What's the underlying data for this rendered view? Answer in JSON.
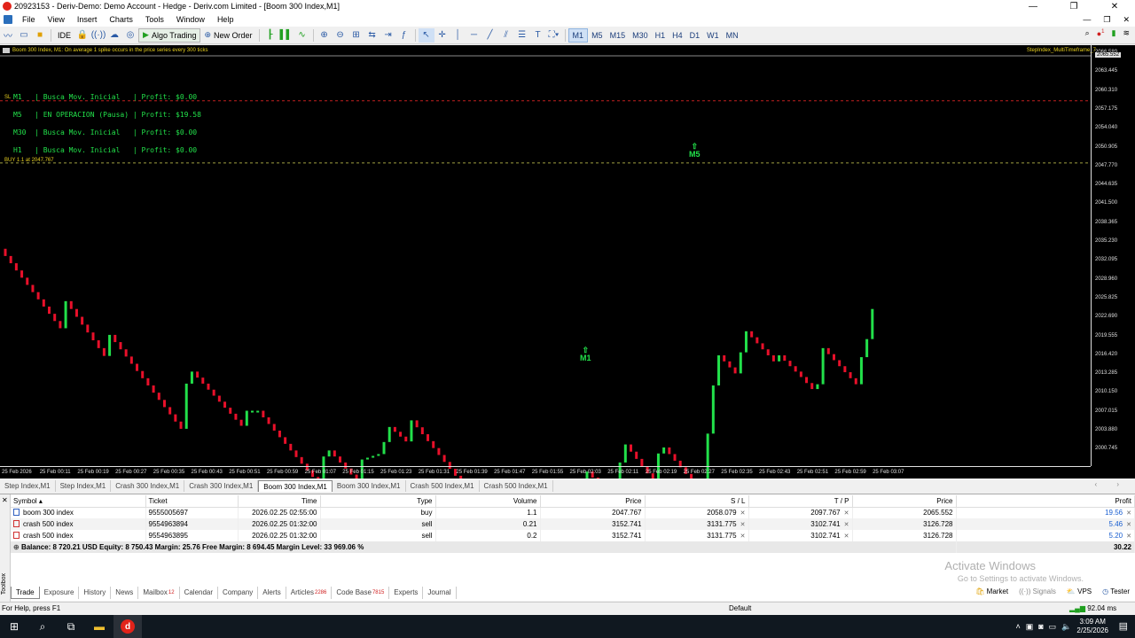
{
  "window": {
    "title": "20923153 - Deriv-Demo: Demo Account - Hedge - Deriv.com Limited - [Boom 300 Index,M1]",
    "minimize": "—",
    "maximize": "❐",
    "close": "✕"
  },
  "menu": {
    "items": [
      "File",
      "View",
      "Insert",
      "Charts",
      "Tools",
      "Window",
      "Help"
    ],
    "mdi_minimize": "—",
    "mdi_restore": "❐",
    "mdi_close": "✕"
  },
  "toolbar": {
    "ide_label": "IDE",
    "algo_trading_label": "Algo Trading",
    "new_order_label": "New Order",
    "timeframes": [
      "M1",
      "M5",
      "M15",
      "M30",
      "H1",
      "H4",
      "D1",
      "W1",
      "MN"
    ],
    "active_timeframe": "M1",
    "notification_count": "1"
  },
  "chart": {
    "header": "Boom 300 Index, M1:  On average 1 spike occurs in the price series every 300 ticks",
    "indicator": "StepIndex_MultiTimeframe_7",
    "sl_tag": "SL",
    "status_lines": [
      "M1   | Busca Mov. Inicial   | Profit: $0.00",
      "M5   | EN OPERACION (Pausa) | Profit: $19.58",
      "M30  | Busca Mov. Inicial   | Profit: $0.00",
      "H1   | Busca Mov. Inicial   | Profit: $0.00"
    ],
    "buy_label": "BUY 1.1 at 2047.767",
    "current_price": "2065.552",
    "price_labels": [
      "2066.580",
      "2063.445",
      "2060.310",
      "2057.175",
      "2054.040",
      "2050.905",
      "2047.770",
      "2044.635",
      "2041.500",
      "2038.365",
      "2035.230",
      "2032.095",
      "2028.960",
      "2025.825",
      "2022.690",
      "2019.555",
      "2016.420",
      "2013.285",
      "2010.150",
      "2007.015",
      "2003.880",
      "2000.745"
    ],
    "time_labels": [
      "25 Feb 2026",
      "25 Feb 00:11",
      "25 Feb 00:19",
      "25 Feb 00:27",
      "25 Feb 00:35",
      "25 Feb 00:43",
      "25 Feb 00:51",
      "25 Feb 00:59",
      "25 Feb 01:07",
      "25 Feb 01:15",
      "25 Feb 01:23",
      "25 Feb 01:31",
      "25 Feb 01:39",
      "25 Feb 01:47",
      "25 Feb 01:55",
      "25 Feb 02:03",
      "25 Feb 02:11",
      "25 Feb 02:19",
      "25 Feb 02:27",
      "25 Feb 02:35",
      "25 Feb 02:43",
      "25 Feb 02:51",
      "25 Feb 02:59",
      "25 Feb 03:07"
    ],
    "markers": [
      "M1",
      "M5"
    ],
    "colors": {
      "bull": "#22e04a",
      "bear": "#e8102a",
      "background": "#000000",
      "text": "#e8d020",
      "status": "#22e04a"
    }
  },
  "chart_tabs": [
    "Step Index,M1",
    "Step Index,M1",
    "Crash 300 Index,M1",
    "Crash 300 Index,M1",
    "Boom 300 Index,M1",
    "Boom 300 Index,M1",
    "Crash 500 Index,M1",
    "Crash 500 Index,M1"
  ],
  "active_chart_tab": 4,
  "trade": {
    "columns": [
      "Symbol",
      "Ticket",
      "Time",
      "Type",
      "Volume",
      "Price",
      "S / L",
      "T / P",
      "Price",
      "Profit"
    ],
    "rows": [
      {
        "symbol": "boom 300 index",
        "ticket": "9555005697",
        "time": "2026.02.25 02:55:00",
        "type": "buy",
        "volume": "1.1",
        "price": "2047.767",
        "sl": "2058.079",
        "tp": "2097.767",
        "cur_price": "2065.552",
        "profit": "19.56"
      },
      {
        "symbol": "crash 500 index",
        "ticket": "9554963894",
        "time": "2026.02.25 01:32:00",
        "type": "sell",
        "volume": "0.21",
        "price": "3152.741",
        "sl": "3131.775",
        "tp": "3102.741",
        "cur_price": "3126.728",
        "profit": "5.46"
      },
      {
        "symbol": "crash 500 index",
        "ticket": "9554963895",
        "time": "2026.02.25 01:32:00",
        "type": "sell",
        "volume": "0.2",
        "price": "3152.741",
        "sl": "3131.775",
        "tp": "3102.741",
        "cur_price": "3126.728",
        "profit": "5.20"
      }
    ],
    "balance_text": "Balance: 8 720.21 USD  Equity: 8 750.43  Margin: 25.76  Free Margin: 8 694.45  Margin Level: 33 969.06 %",
    "total_profit": "30.22"
  },
  "watermark": {
    "title": "Activate Windows",
    "subtitle": "Go to Settings to activate Windows."
  },
  "toolbox": {
    "side_label": "Toolbox",
    "tabs": [
      {
        "label": "Trade",
        "badge": ""
      },
      {
        "label": "Exposure",
        "badge": ""
      },
      {
        "label": "History",
        "badge": ""
      },
      {
        "label": "News",
        "badge": ""
      },
      {
        "label": "Mailbox",
        "badge": "12"
      },
      {
        "label": "Calendar",
        "badge": ""
      },
      {
        "label": "Company",
        "badge": ""
      },
      {
        "label": "Alerts",
        "badge": ""
      },
      {
        "label": "Articles",
        "badge": "2286"
      },
      {
        "label": "Code Base",
        "badge": "7815"
      },
      {
        "label": "Experts",
        "badge": ""
      },
      {
        "label": "Journal",
        "badge": ""
      }
    ],
    "market_label": "Market",
    "signals_label": "Signals",
    "vps_label": "VPS",
    "tester_label": "Tester"
  },
  "status": {
    "help": "For Help, press F1",
    "profile": "Default",
    "ping": "92.04 ms"
  },
  "taskbar": {
    "time": "3:09 AM",
    "date": "2/25/2026"
  }
}
